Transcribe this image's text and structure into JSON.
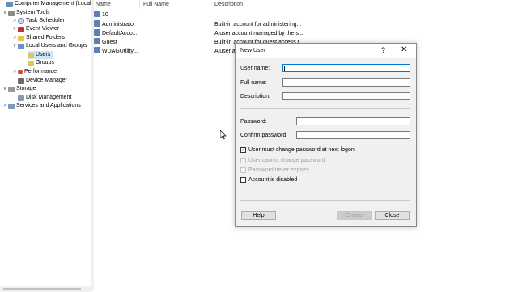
{
  "tree": {
    "items": [
      {
        "label": "Computer Management (Local",
        "icon": "computer-icon",
        "toggle": ""
      },
      {
        "label": "System Tools",
        "icon": "system-tools-icon",
        "toggle": "v"
      },
      {
        "label": "Task Scheduler",
        "icon": "task-scheduler-icon",
        "toggle": ">"
      },
      {
        "label": "Event Viewer",
        "icon": "event-viewer-icon",
        "toggle": ">"
      },
      {
        "label": "Shared Folders",
        "icon": "shared-folders-icon",
        "toggle": ">"
      },
      {
        "label": "Local Users and Groups",
        "icon": "local-users-groups-icon",
        "toggle": "v"
      },
      {
        "label": "Users",
        "icon": "folder-icon",
        "toggle": ""
      },
      {
        "label": "Groups",
        "icon": "folder-icon",
        "toggle": ""
      },
      {
        "label": "Performance",
        "icon": "performance-icon",
        "toggle": ">"
      },
      {
        "label": "Device Manager",
        "icon": "device-manager-icon",
        "toggle": ""
      },
      {
        "label": "Storage",
        "icon": "storage-icon",
        "toggle": "v"
      },
      {
        "label": "Disk Management",
        "icon": "disk-management-icon",
        "toggle": ""
      },
      {
        "label": "Services and Applications",
        "icon": "services-icon",
        "toggle": ">"
      }
    ]
  },
  "list": {
    "columns": [
      "Name",
      "Full Name",
      "Description"
    ],
    "rows": [
      {
        "name": "10",
        "full_name": "",
        "description": ""
      },
      {
        "name": "Administrator",
        "full_name": "",
        "description": "Built-in account for administering..."
      },
      {
        "name": "DefaultAcco...",
        "full_name": "",
        "description": "A user account managed by the s..."
      },
      {
        "name": "Guest",
        "full_name": "",
        "description": "Built-in account for guest access t..."
      },
      {
        "name": "WDAGUtility...",
        "full_name": "",
        "description": "A user account managed and use..."
      }
    ]
  },
  "dialog": {
    "title": "New User",
    "help_glyph": "?",
    "close_glyph": "✕",
    "fields": {
      "user_name_label": "User name:",
      "user_name_value": "",
      "full_name_label": "Full name:",
      "full_name_value": "",
      "description_label": "Description:",
      "description_value": "",
      "password_label": "Password:",
      "password_value": "",
      "confirm_label": "Confirm password:",
      "confirm_value": ""
    },
    "checkboxes": {
      "must_change": "User must change password at next logon",
      "cannot_change": "User cannot change password",
      "never_expires": "Password never expires",
      "disabled": "Account is disabled"
    },
    "buttons": {
      "help": "Help",
      "create": "Create",
      "close": "Close"
    }
  }
}
